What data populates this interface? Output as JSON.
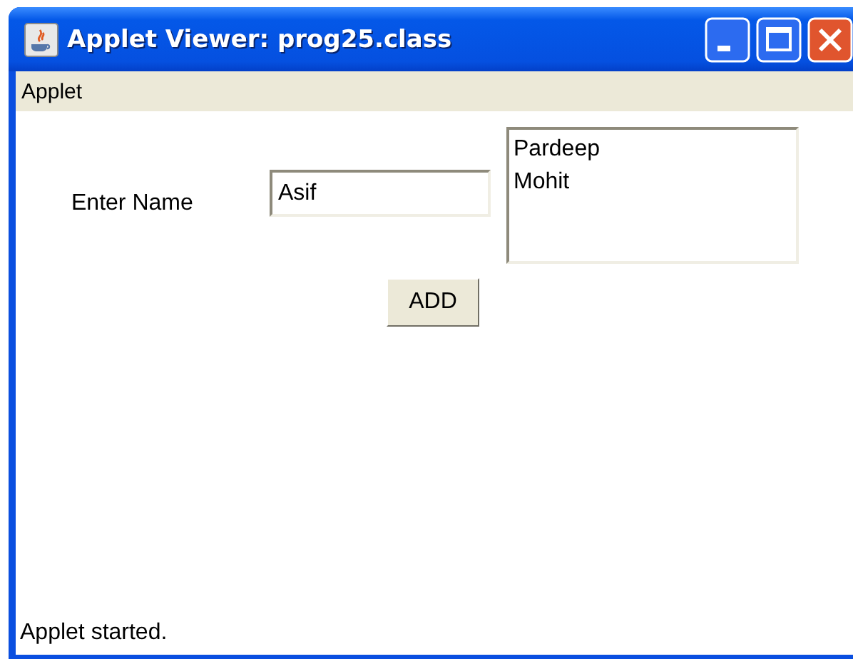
{
  "window": {
    "title": "Applet Viewer: prog25.class"
  },
  "menu": [
    "Applet"
  ],
  "form": {
    "label": "Enter Name",
    "field_value": "Asif",
    "list_items": [
      "Pardeep",
      "Mohit"
    ],
    "button": "ADD"
  },
  "status_bar": "Applet started."
}
